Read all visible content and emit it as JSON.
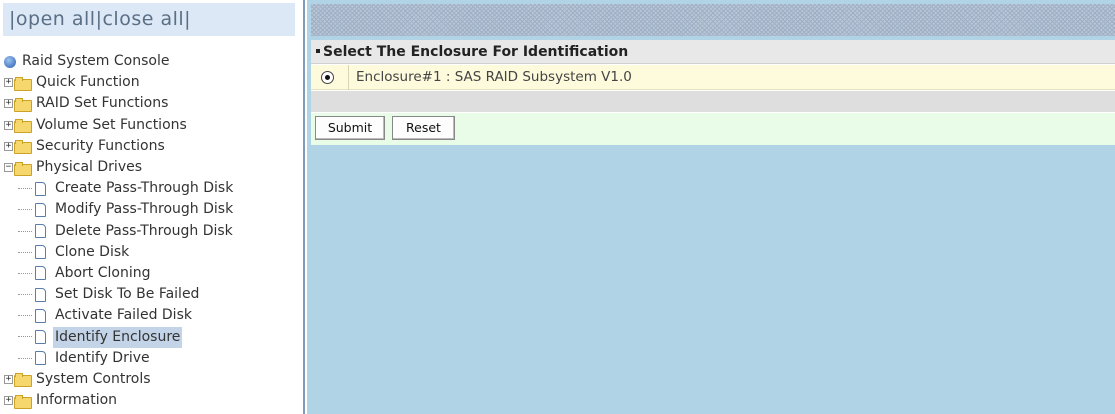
{
  "topbar": {
    "open_all": "open all",
    "close_all": "close all",
    "sep": "|"
  },
  "tree": {
    "root_label": "Raid System Console",
    "folders_top": [
      "Quick Function",
      "RAID Set Functions",
      "Volume Set Functions",
      "Security Functions"
    ],
    "open_folder": "Physical Drives",
    "children": [
      "Create Pass-Through Disk",
      "Modify Pass-Through Disk",
      "Delete Pass-Through Disk",
      "Clone Disk",
      "Abort Cloning",
      "Set Disk To Be Failed",
      "Activate Failed Disk",
      "Identify Enclosure",
      "Identify Drive"
    ],
    "selected_child": "Identify Enclosure",
    "folders_bottom": [
      "System Controls",
      "Information"
    ],
    "expander_plus": "+",
    "expander_minus": "−"
  },
  "panel": {
    "title": "Select The Enclosure For Identification",
    "enclosure_option": "Enclosure#1 : SAS RAID Subsystem V1.0",
    "enclosure_selected": true,
    "submit_label": "Submit",
    "reset_label": "Reset"
  },
  "colors": {
    "frame_background": "#b0d4e6",
    "topbar_background": "#dce8f5",
    "option_row": "#fdfbdc",
    "button_row": "#e8fce8",
    "selected_highlight": "#c4d4e8"
  }
}
